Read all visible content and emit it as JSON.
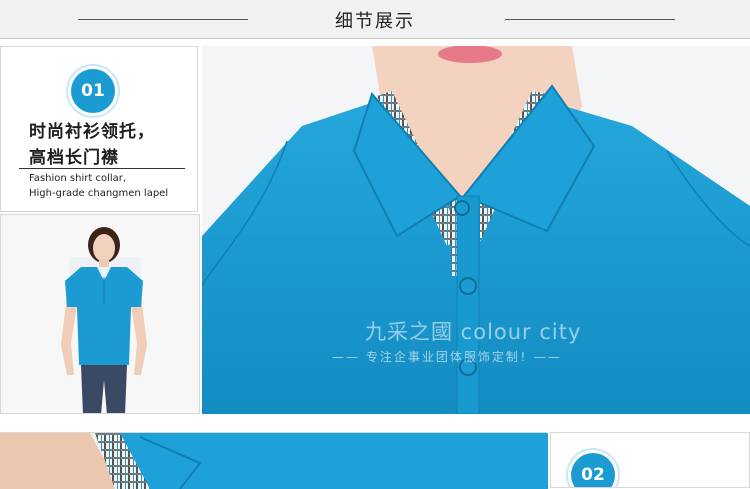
{
  "header": {
    "title": "细节展示"
  },
  "section1": {
    "number": "01",
    "title_line1": "时尚衬衫领托，",
    "title_line2": "高档长门襟",
    "desc_line1": "Fashion shirt collar,",
    "desc_line2": "High-grade changmen lapel"
  },
  "watermark": {
    "brand": "九采之國 colour city",
    "slogan": "—— 专注企事业团体服饰定制！——"
  },
  "section2": {
    "number": "02"
  },
  "colors": {
    "accent": "#1a9cd3",
    "shirt": "#1b9bd1",
    "header_bg": "#f1f1f1"
  }
}
